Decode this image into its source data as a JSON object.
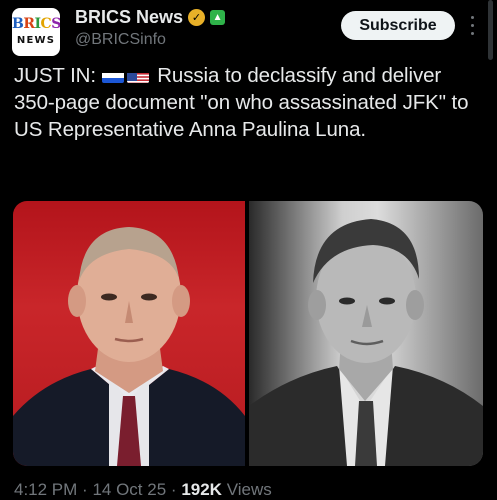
{
  "account": {
    "avatar_text_top": "BRICS",
    "avatar_text_bottom": "NEWS",
    "name": "BRICS News",
    "handle": "@BRICSinfo"
  },
  "actions": {
    "subscribe_label": "Subscribe"
  },
  "tweet": {
    "prefix": "JUST IN:",
    "flags": [
      "russia-flag",
      "usa-flag"
    ],
    "body": "Russia to declassify and deliver 350-page document \"on who assassinated JFK\" to US Representative Anna Paulina Luna."
  },
  "images": {
    "left_icon": "putin-photo",
    "right_icon": "jfk-photo"
  },
  "meta": {
    "time": "4:12 PM",
    "sep1": "·",
    "date": "14 Oct 25",
    "sep2": "·",
    "views_count": "192K",
    "views_label": "Views"
  },
  "colors": {
    "background": "#000000",
    "text": "#e7e9ea",
    "muted": "#71767b",
    "gold_badge": "#e8b028",
    "green_badge": "#2fb34a"
  }
}
